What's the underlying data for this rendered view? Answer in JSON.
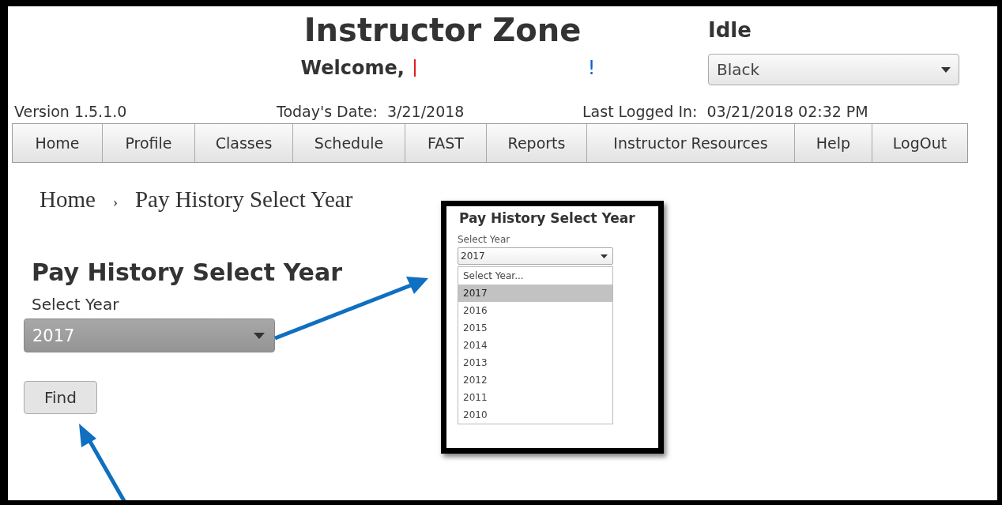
{
  "header": {
    "title": "Instructor Zone",
    "status": "Idle",
    "welcome": "Welcome,",
    "welcome_end": "!",
    "theme_select": {
      "value": "Black"
    }
  },
  "info": {
    "version": "Version 1.5.1.0",
    "date_label": "Today's Date:",
    "date": "3/21/2018",
    "last_label": "Last Logged In:",
    "last": "03/21/2018 02:32 PM"
  },
  "nav": [
    {
      "label": "Home"
    },
    {
      "label": "Profile"
    },
    {
      "label": "Classes"
    },
    {
      "label": "Schedule"
    },
    {
      "label": "FAST"
    },
    {
      "label": "Reports"
    },
    {
      "label": "Instructor Resources"
    },
    {
      "label": "Help"
    },
    {
      "label": "LogOut"
    }
  ],
  "breadcrumb": {
    "items": [
      {
        "label": "Home"
      },
      {
        "label": "Pay History Select Year"
      }
    ],
    "separator": "›"
  },
  "page": {
    "heading": "Pay History Select Year",
    "label": "Select Year",
    "select": {
      "value": "2017"
    },
    "find_button": "Find"
  },
  "inset": {
    "heading": "Pay History Select Year",
    "label": "Select Year",
    "select": {
      "value": "2017"
    },
    "options": [
      {
        "label": "Select Year...",
        "selected": false
      },
      {
        "label": "2017",
        "selected": true
      },
      {
        "label": "2016",
        "selected": false
      },
      {
        "label": "2015",
        "selected": false
      },
      {
        "label": "2014",
        "selected": false
      },
      {
        "label": "2013",
        "selected": false
      },
      {
        "label": "2012",
        "selected": false
      },
      {
        "label": "2011",
        "selected": false
      },
      {
        "label": "2010",
        "selected": false
      }
    ]
  }
}
